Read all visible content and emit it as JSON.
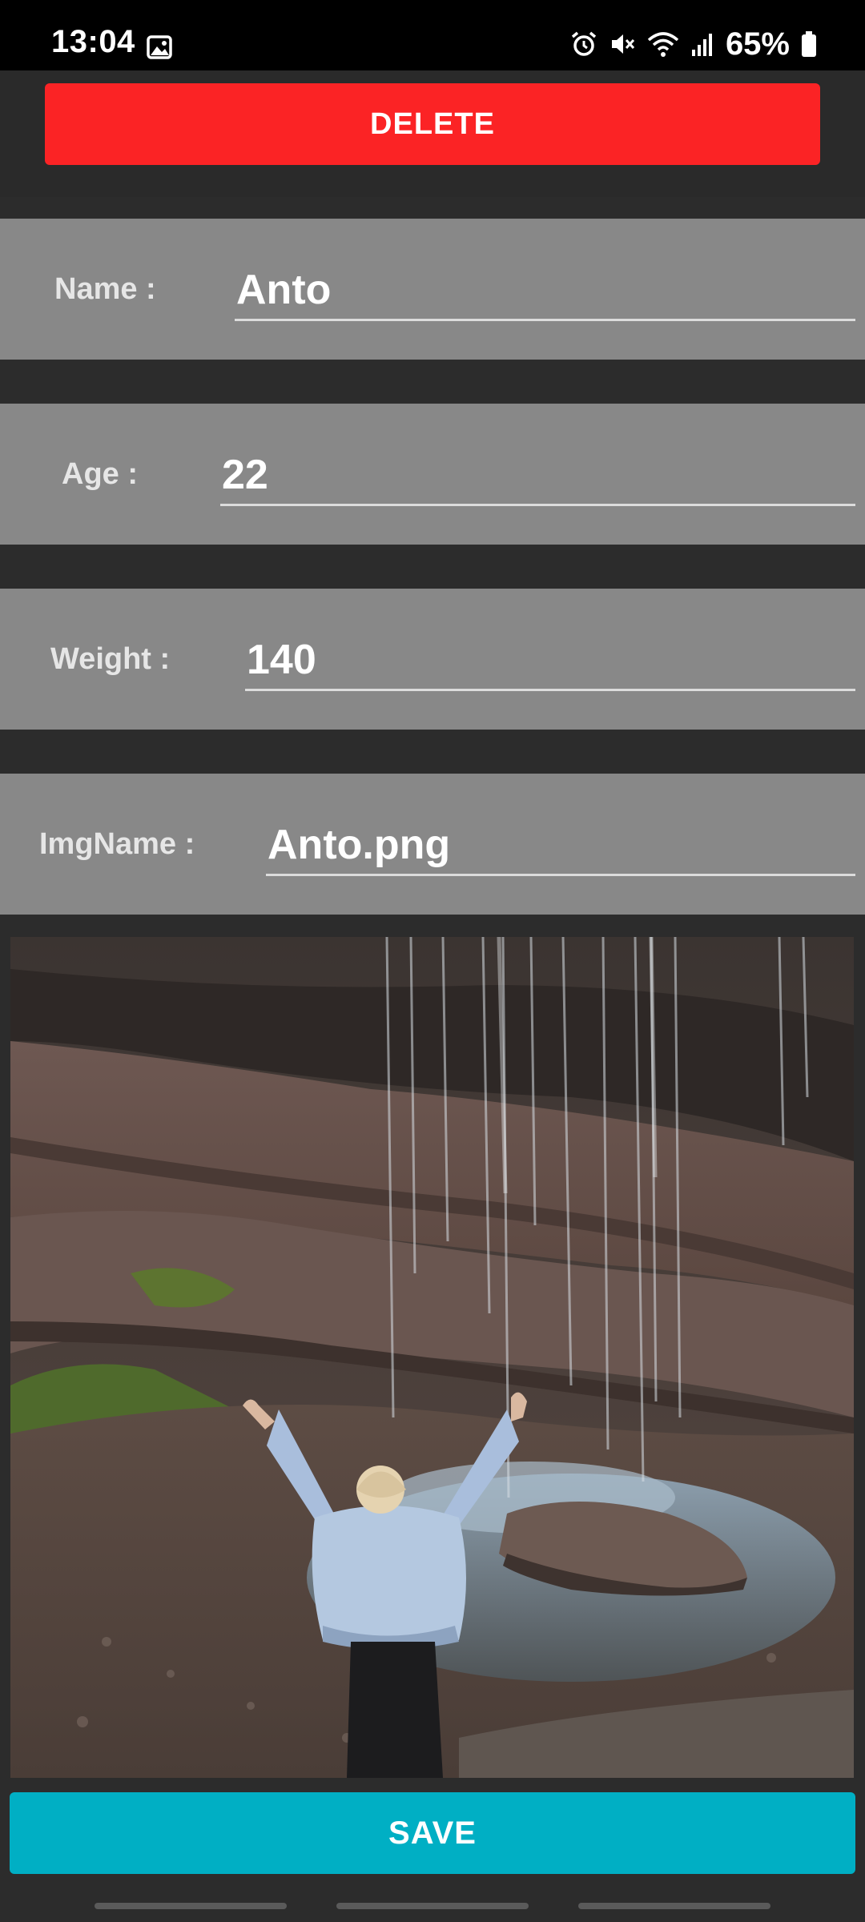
{
  "status_bar": {
    "time": "13:04",
    "battery": "65%",
    "icons": [
      "gallery-icon",
      "alarm-icon",
      "mute-icon",
      "wifi-icon",
      "signal-icon",
      "battery-icon"
    ]
  },
  "actions": {
    "delete_label": "DELETE",
    "save_label": "SAVE"
  },
  "fields": {
    "name": {
      "label": "Name :",
      "value": "Anto"
    },
    "age": {
      "label": "Age :",
      "value": "22"
    },
    "weight": {
      "label": "Weight :",
      "value": "140"
    },
    "imgname": {
      "label": "ImgName :",
      "value": "Anto.png"
    }
  },
  "colors": {
    "delete": "#fb2325",
    "save": "#00afc4",
    "field_bg": "#888888",
    "background": "#2c2c2c"
  }
}
